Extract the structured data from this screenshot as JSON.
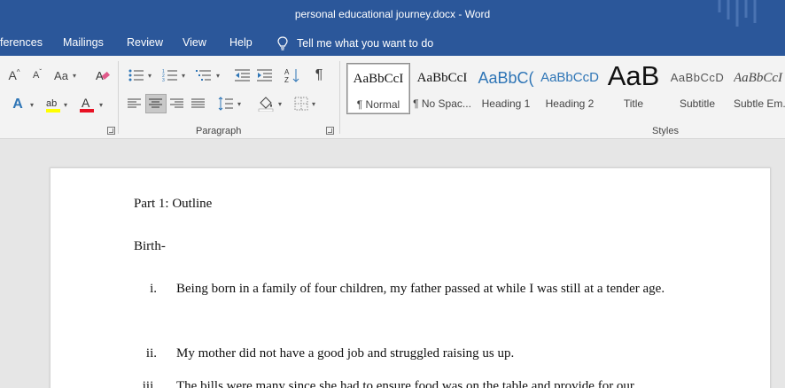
{
  "window": {
    "title": "personal educational journey.docx  -  Word"
  },
  "menu": {
    "tabs": [
      "ferences",
      "Mailings",
      "Review",
      "View",
      "Help"
    ],
    "tell_me": "Tell me what you want to do"
  },
  "ribbon": {
    "font_group": {
      "change_case_label": "Aa"
    },
    "paragraph_group": {
      "label": "Paragraph"
    },
    "styles_group": {
      "label": "Styles",
      "items": [
        {
          "sample": "AaBbCcI",
          "name": "¶ Normal"
        },
        {
          "sample": "AaBbCcI",
          "name": "¶ No Spac..."
        },
        {
          "sample": "AaBbC(",
          "name": "Heading 1"
        },
        {
          "sample": "AaBbCcD",
          "name": "Heading 2"
        },
        {
          "sample": "AaB",
          "name": "Title"
        },
        {
          "sample": "AaBbCcD",
          "name": "Subtitle"
        },
        {
          "sample": "AaBbCcI",
          "name": "Subtle Em..."
        }
      ]
    }
  },
  "document": {
    "heading": "Part 1: Outline",
    "section": "Birth-",
    "list": [
      {
        "num": "i.",
        "text": "Being born in a family of four children, my father passed at while I was still at a tender age."
      },
      {
        "num": "ii.",
        "text": "My mother did not have a good job and struggled raising us up."
      },
      {
        "num": "iii.",
        "text": "The bills were many since she had to ensure food was on the table and provide for our"
      }
    ]
  },
  "colors": {
    "brand": "#2b579a",
    "ribbon_bg": "#f3f3f3",
    "highlight": "#ffff00",
    "font_color": "#e81123",
    "text_effects": "#2e75b6"
  }
}
